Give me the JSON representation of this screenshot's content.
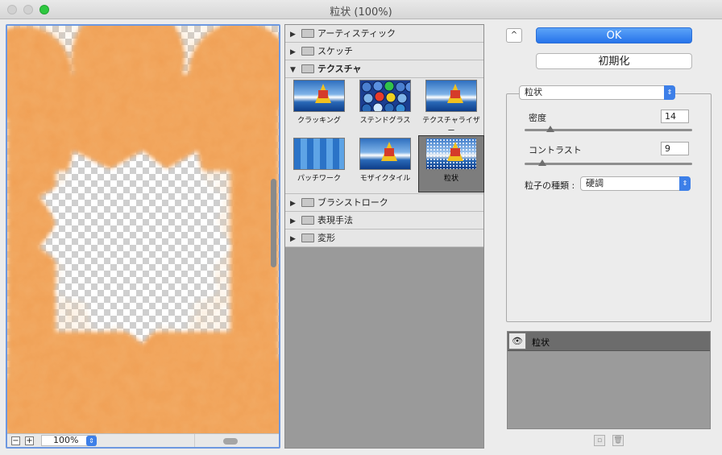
{
  "window": {
    "title": "粒状 (100%)"
  },
  "preview": {
    "zoom_out_label": "−",
    "zoom_in_label": "+",
    "zoom_value": "100%"
  },
  "categories": [
    {
      "label": "アーティスティック",
      "expanded": false
    },
    {
      "label": "スケッチ",
      "expanded": false
    },
    {
      "label": "テクスチャ",
      "expanded": true
    },
    {
      "label": "ブラシストローク",
      "expanded": false
    },
    {
      "label": "表現手法",
      "expanded": false
    },
    {
      "label": "変形",
      "expanded": false
    }
  ],
  "texture_filters": [
    {
      "label": "クラッキング"
    },
    {
      "label": "ステンドグラス"
    },
    {
      "label": "テクスチャライザー"
    },
    {
      "label": "パッチワーク"
    },
    {
      "label": "モザイクタイル"
    },
    {
      "label": "粒状",
      "selected": true
    }
  ],
  "buttons": {
    "ok": "OK",
    "reset": "初期化",
    "collapse": "^"
  },
  "settings": {
    "filter_select": "粒状",
    "density": {
      "label": "密度",
      "value": "14"
    },
    "contrast": {
      "label": "コントラスト",
      "value": "9"
    },
    "grain_type": {
      "label": "粒子の種類 :",
      "value": "硬調"
    }
  },
  "layers": {
    "item": "粒状"
  },
  "colors": {
    "accent": "#2673ea",
    "selection_border": "#6d98e0",
    "orange": "#f0a055"
  }
}
